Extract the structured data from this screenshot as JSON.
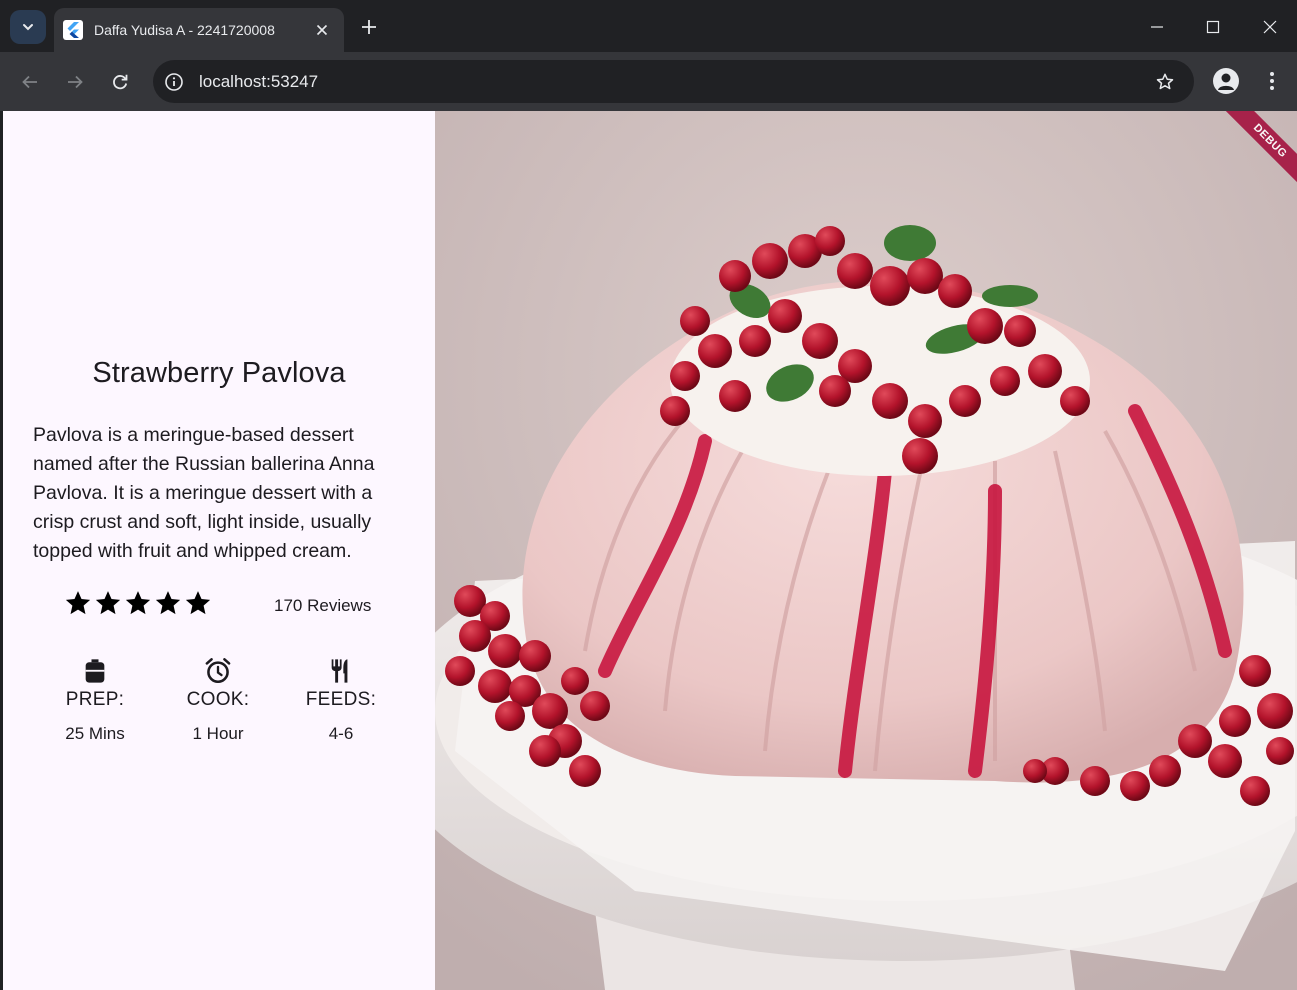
{
  "browser": {
    "tab_title": "Daffa Yudisa A - 2241720008",
    "url": "localhost:53247"
  },
  "recipe": {
    "title": "Strawberry Pavlova",
    "description": "Pavlova is a meringue-based dessert named after the Russian ballerina Anna Pavlova. It is a meringue dessert with a crisp crust and soft, light inside, usually topped with fruit and whipped cream.",
    "rating_stars": 5,
    "reviews": "170 Reviews",
    "info": [
      {
        "icon": "kitchen-icon",
        "label": "PREP:",
        "value": "25 Mins"
      },
      {
        "icon": "timer-icon",
        "label": "COOK:",
        "value": "1 Hour"
      },
      {
        "icon": "restaurant-icon",
        "label": "FEEDS:",
        "value": "4-6"
      }
    ]
  },
  "banner": {
    "debug_label": "DEBUG"
  }
}
